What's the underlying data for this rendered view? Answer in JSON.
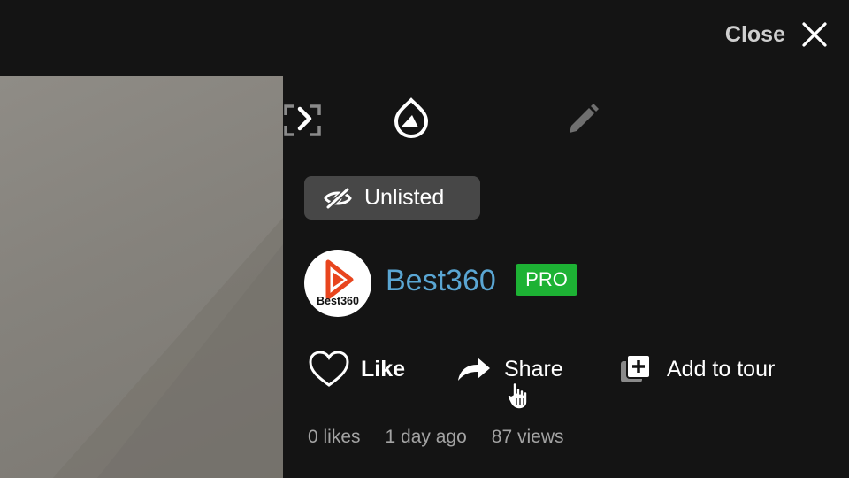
{
  "header": {
    "close_label": "Close"
  },
  "visibility": {
    "label": "Unlisted"
  },
  "user": {
    "name": "Best360",
    "badge": "PRO",
    "logo_text": "Best360"
  },
  "actions": {
    "like": "Like",
    "share": "Share",
    "add_to_tour": "Add to tour"
  },
  "stats": {
    "likes": "0 likes",
    "date": "1 day ago",
    "views": "87 views"
  },
  "colors": {
    "accent_link": "#5aa6d3",
    "pro_green": "#1db234",
    "logo_orange": "#e8451e"
  },
  "icons": [
    "close-icon",
    "chevron-right-icon",
    "drop-icon",
    "pencil-icon",
    "fullscreen-icon",
    "eye-off-icon",
    "heart-icon",
    "share-arrow-icon",
    "add-to-tour-icon",
    "hand-cursor-icon"
  ]
}
